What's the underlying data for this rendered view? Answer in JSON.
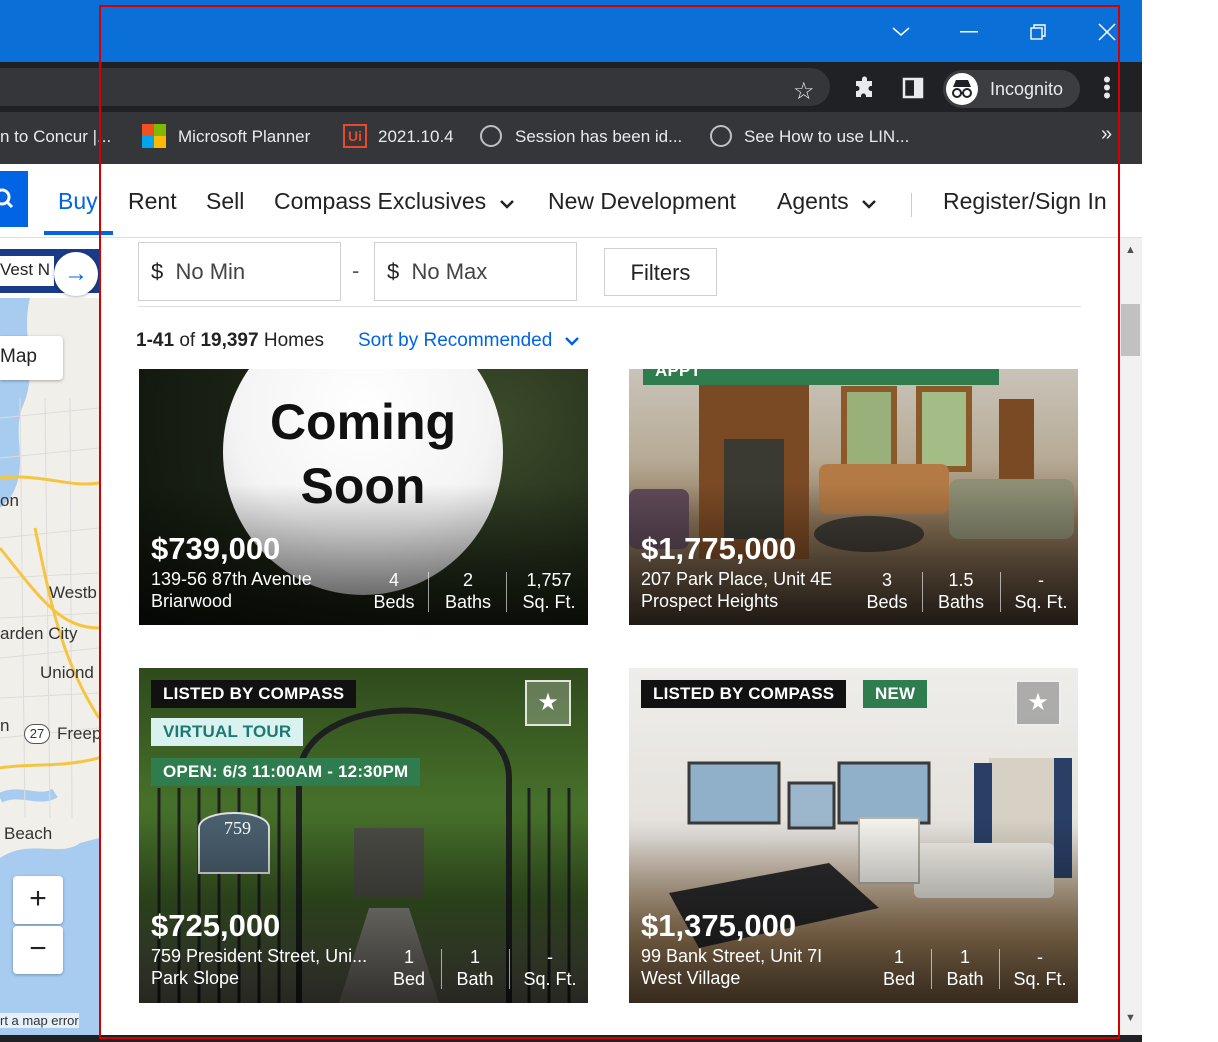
{
  "browser": {
    "bookmarks": [
      {
        "label": "n to Concur |..."
      },
      {
        "label": "Microsoft Planner"
      },
      {
        "label": "2021.10.4"
      },
      {
        "label": "Session has been id..."
      },
      {
        "label": "See How to use LIN..."
      }
    ],
    "overflow": "»",
    "incognito_label": "Incognito"
  },
  "site_nav": {
    "items": [
      "Buy",
      "Rent",
      "Sell",
      "Compass Exclusives",
      "New Development",
      "Agents"
    ],
    "dropdown_chevron": "❯",
    "register": "Register/Sign In"
  },
  "map": {
    "location_input": "Vest N",
    "map_button": "Map",
    "labels": [
      "on",
      "Westb",
      "arden City",
      "Uniond",
      "n",
      "Freep",
      "Beach"
    ],
    "route_shield": "27",
    "zoom_in": "+",
    "zoom_out": "−",
    "error_link": "rt a map error"
  },
  "filters": {
    "min_currency": "$",
    "min_placeholder": "No Min",
    "dash": "-",
    "max_currency": "$",
    "max_placeholder": "No Max",
    "filters_button": "Filters"
  },
  "results": {
    "range": "1-41",
    "of": "of",
    "total": "19,397",
    "unit": "Homes",
    "sort_label": "Sort by Recommended"
  },
  "listings": [
    {
      "price": "$739,000",
      "address": "139-56 87th Avenue",
      "neighborhood": "Briarwood",
      "beds_value": "4",
      "beds_label": "Beds",
      "baths_value": "2",
      "baths_label": "Baths",
      "sqft_value": "1,757",
      "sqft_label": "Sq. Ft.",
      "overlay_line1": "Coming",
      "overlay_line2": "Soon"
    },
    {
      "price": "$1,775,000",
      "address": "207 Park Place, Unit 4E",
      "neighborhood": "Prospect Heights",
      "beds_value": "3",
      "beds_label": "Beds",
      "baths_value": "1.5",
      "baths_label": "Baths",
      "sqft_value": "-",
      "sqft_label": "Sq. Ft.",
      "badge": "APPT"
    },
    {
      "price": "$725,000",
      "address": "759 President Street, Uni...",
      "neighborhood": "Park Slope",
      "beds_value": "1",
      "beds_label": "Bed",
      "baths_value": "1",
      "baths_label": "Bath",
      "sqft_value": "-",
      "sqft_label": "Sq. Ft.",
      "badges": [
        "LISTED BY COMPASS",
        "VIRTUAL TOUR",
        "OPEN: 6/3 11:00AM - 12:30PM"
      ],
      "sign_text": "759"
    },
    {
      "price": "$1,375,000",
      "address": "99 Bank Street, Unit 7I",
      "neighborhood": "West Village",
      "beds_value": "1",
      "beds_label": "Bed",
      "baths_value": "1",
      "baths_label": "Bath",
      "sqft_value": "-",
      "sqft_label": "Sq. Ft.",
      "badges": [
        "LISTED BY COMPASS",
        "NEW"
      ]
    }
  ],
  "colors": {
    "brand_blue": "#0064e5",
    "titlebar_blue": "#0a6fd6",
    "badge_green": "#2f7d4f",
    "frame_red": "#d40000"
  }
}
